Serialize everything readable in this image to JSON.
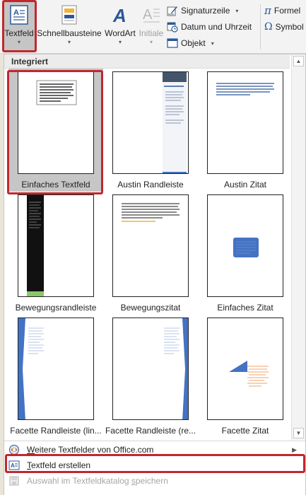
{
  "ribbon": {
    "buttons": [
      {
        "label": "Textfeld",
        "caret": "▾"
      },
      {
        "label": "Schnellbausteine",
        "caret": "▾"
      },
      {
        "label": "WordArt",
        "caret": "▾"
      },
      {
        "label": "Initiale",
        "caret": "▾"
      }
    ],
    "small_items": [
      {
        "label": "Signaturzeile",
        "caret": "▾"
      },
      {
        "label": "Datum und Uhrzeit"
      },
      {
        "label": "Objekt",
        "caret": "▾"
      }
    ],
    "right_items": [
      {
        "label": "Formel"
      },
      {
        "label": "Symbol"
      }
    ]
  },
  "gallery": {
    "section_title": "Integriert",
    "tiles": [
      {
        "label": "Einfaches Textfeld"
      },
      {
        "label": "Austin Randleiste"
      },
      {
        "label": "Austin Zitat"
      },
      {
        "label": "Bewegungsrandleiste"
      },
      {
        "label": "Bewegungszitat"
      },
      {
        "label": "Einfaches Zitat"
      },
      {
        "label": "Facette Randleiste (lin..."
      },
      {
        "label": "Facette Randleiste (re..."
      },
      {
        "label": "Facette Zitat"
      }
    ]
  },
  "menu": {
    "more_prefix": "W",
    "more_rest": "eitere Textfelder von Office.com",
    "create_prefix": "T",
    "create_rest": "extfeld erstellen",
    "save_pre": "Auswahl im Textfeldkatalog ",
    "save_u": "s",
    "save_post": "peichern"
  },
  "colors": {
    "highlight": "#c0282d",
    "accent_blue": "#2b579a"
  }
}
